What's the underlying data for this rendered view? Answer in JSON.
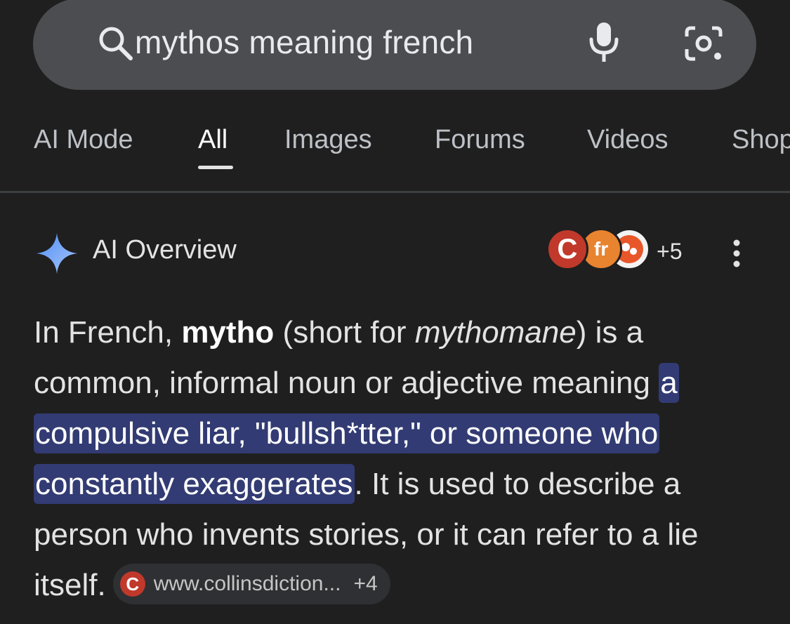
{
  "search": {
    "query": "mythos meaning french"
  },
  "tabs": [
    {
      "label": "AI Mode"
    },
    {
      "label": "All",
      "active": true
    },
    {
      "label": "Images"
    },
    {
      "label": "Forums"
    },
    {
      "label": "Videos"
    },
    {
      "label": "Shop"
    }
  ],
  "ai_overview": {
    "title": "AI Overview",
    "sources_extra": "+5",
    "source_favicons": [
      "C",
      "fr",
      ""
    ],
    "paragraph": {
      "t1": "In French, ",
      "t2_bold": "mytho",
      "t3": " (short for ",
      "t4_italic": "mythomane",
      "t5": ") is a common, informal noun or adjective meaning ",
      "t6_highlight": "a compulsive liar, \"bullsh*tter,\" or someone who constantly exaggerates",
      "t7": ". It is used to describe a person who invents stories, or it can refer to a lie itself."
    },
    "citation": {
      "favicon": "C",
      "url": "www.collinsdiction...",
      "extra": "+4"
    }
  },
  "colors": {
    "background": "#1f1f1f",
    "search_bar": "#4b4d50",
    "highlight": "#323b73",
    "sparkle": "#8ab4f8"
  }
}
